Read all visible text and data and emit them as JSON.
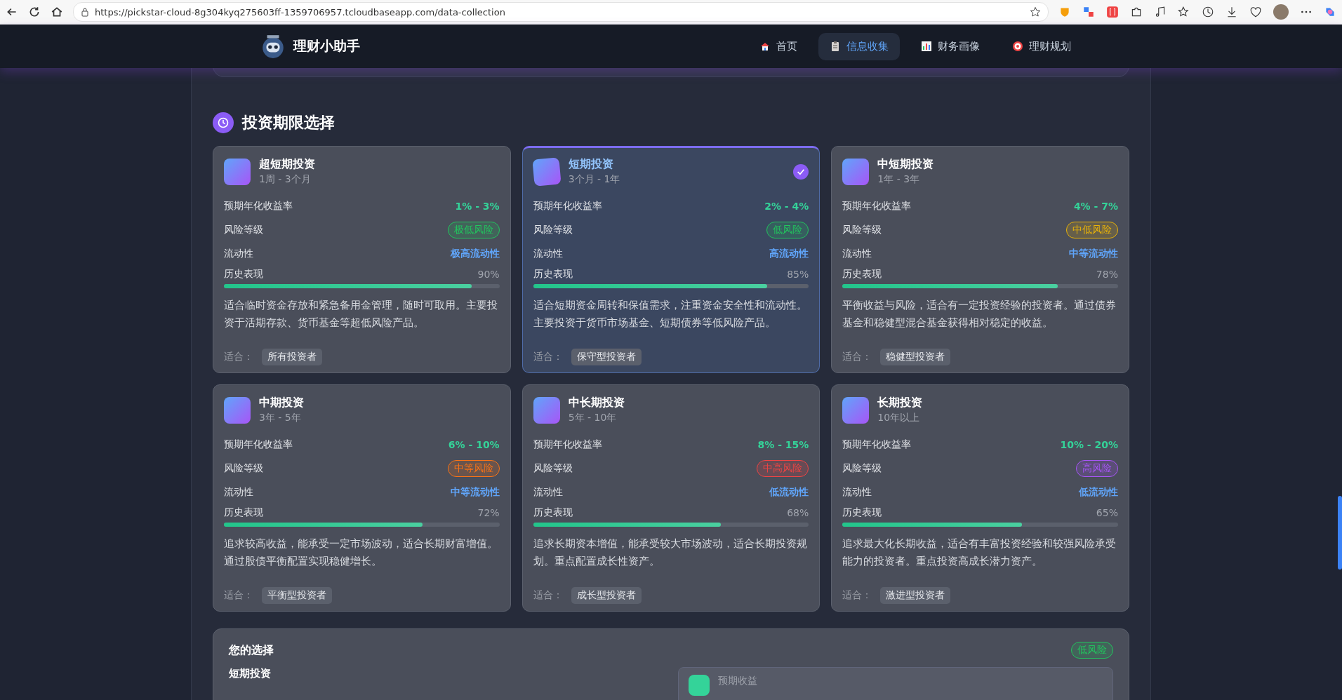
{
  "browser": {
    "url": "https://pickstar-cloud-8g304kyq275603ff-1359706957.tcloudbaseapp.com/data-collection"
  },
  "app": {
    "brand": "理财小助手",
    "nav": [
      {
        "label": "首页",
        "selected": false
      },
      {
        "label": "信息收集",
        "selected": true
      },
      {
        "label": "财务画像",
        "selected": false
      },
      {
        "label": "理财规划",
        "selected": false
      }
    ]
  },
  "section": {
    "title": "投资期限选择",
    "options": [
      {
        "title": "超短期投资",
        "period": "1周 - 3个月",
        "selected": false,
        "return_label": "预期年化收益率",
        "return": "1% - 3%",
        "risk_label": "风险等级",
        "risk": "极低风险",
        "color": "#22c55e",
        "liquidity_label": "流动性",
        "liquidity": "极高流动性",
        "history_label": "历史表现",
        "history": "90%",
        "level": 0.9,
        "description": "适合临时资金存放和紧急备用金管理，随时可取用。主要投资于活期存款、货币基金等超低风险产品。",
        "suitable_label": "适合：",
        "suitable": "所有投资者"
      },
      {
        "title": "短期投资",
        "period": "3个月 - 1年",
        "selected": true,
        "return_label": "预期年化收益率",
        "return": "2% - 4%",
        "risk_label": "风险等级",
        "risk": "低风险",
        "color": "#22c55e",
        "liquidity_label": "流动性",
        "liquidity": "高流动性",
        "history_label": "历史表现",
        "history": "85%",
        "level": 0.85,
        "description": "适合短期资金周转和保值需求，注重资金安全性和流动性。主要投资于货币市场基金、短期债券等低风险产品。",
        "suitable_label": "适合：",
        "suitable": "保守型投资者"
      },
      {
        "title": "中短期投资",
        "period": "1年 - 3年",
        "selected": false,
        "return_label": "预期年化收益率",
        "return": "4% - 7%",
        "risk_label": "风险等级",
        "risk": "中低风险",
        "color": "#eab308",
        "liquidity_label": "流动性",
        "liquidity": "中等流动性",
        "history_label": "历史表现",
        "history": "78%",
        "level": 0.78,
        "description": "平衡收益与风险，适合有一定投资经验的投资者。通过债券基金和稳健型混合基金获得相对稳定的收益。",
        "suitable_label": "适合：",
        "suitable": "稳健型投资者"
      },
      {
        "title": "中期投资",
        "period": "3年 - 5年",
        "selected": false,
        "return_label": "预期年化收益率",
        "return": "6% - 10%",
        "risk_label": "风险等级",
        "risk": "中等风险",
        "color": "#f97316",
        "liquidity_label": "流动性",
        "liquidity": "中等流动性",
        "history_label": "历史表现",
        "history": "72%",
        "level": 0.72,
        "description": "追求较高收益，能承受一定市场波动，适合长期财富增值。通过股债平衡配置实现稳健增长。",
        "suitable_label": "适合：",
        "suitable": "平衡型投资者"
      },
      {
        "title": "中长期投资",
        "period": "5年 - 10年",
        "selected": false,
        "return_label": "预期年化收益率",
        "return": "8% - 15%",
        "risk_label": "风险等级",
        "risk": "中高风险",
        "color": "#ef4444",
        "liquidity_label": "流动性",
        "liquidity": "低流动性",
        "history_label": "历史表现",
        "history": "68%",
        "level": 0.68,
        "description": "追求长期资本增值，能承受较大市场波动，适合长期投资规划。重点配置成长性资产。",
        "suitable_label": "适合：",
        "suitable": "成长型投资者"
      },
      {
        "title": "长期投资",
        "period": "10年以上",
        "selected": false,
        "return_label": "预期年化收益率",
        "return": "10% - 20%",
        "risk_label": "风险等级",
        "risk": "高风险",
        "color": "#a855f7",
        "liquidity_label": "流动性",
        "liquidity": "低流动性",
        "history_label": "历史表现",
        "history": "65%",
        "level": 0.65,
        "description": "追求最大化长期收益，适合有丰富投资经验和较强风险承受能力的投资者。重点投资高成长潜力资产。",
        "suitable_label": "适合：",
        "suitable": "激进型投资者"
      }
    ]
  },
  "summary": {
    "title": "您的选择",
    "risk": "低风险",
    "color": "#22c55e",
    "choice": "短期投资",
    "stat_label": "预期收益"
  }
}
